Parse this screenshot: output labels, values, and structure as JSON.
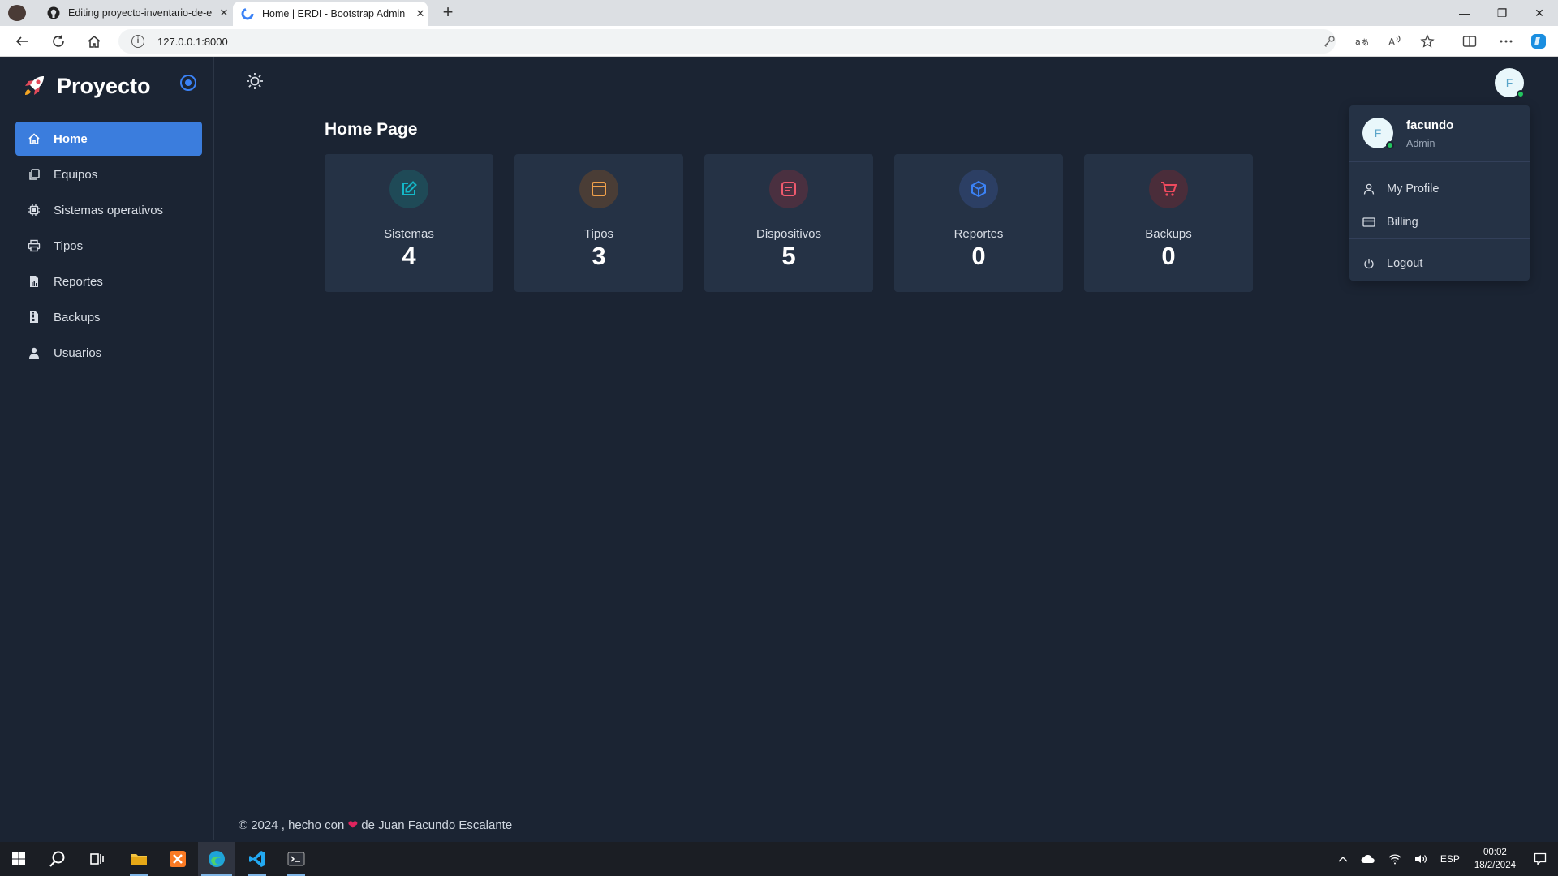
{
  "browser": {
    "tabs": [
      {
        "title": "Editing proyecto-inventario-de-e",
        "close": "✕"
      },
      {
        "title": "Home | ERDI - Bootstrap Admin",
        "close": "✕"
      }
    ],
    "new_tab": "+",
    "url": "127.0.0.1:8000",
    "window_controls": {
      "minimize": "—",
      "restore": "❐",
      "close": "✕"
    }
  },
  "brand": {
    "name": "Proyecto"
  },
  "sidebar": {
    "items": [
      {
        "label": "Home",
        "icon": "home-icon",
        "active": true
      },
      {
        "label": "Equipos",
        "icon": "copy-icon"
      },
      {
        "label": "Sistemas operativos",
        "icon": "cpu-icon"
      },
      {
        "label": "Tipos",
        "icon": "printer-icon"
      },
      {
        "label": "Reportes",
        "icon": "file-chart-icon"
      },
      {
        "label": "Backups",
        "icon": "file-archive-icon"
      },
      {
        "label": "Usuarios",
        "icon": "users-icon"
      }
    ]
  },
  "main": {
    "page_title": "Home Page",
    "cards": [
      {
        "label": "Sistemas",
        "value": "4",
        "icon": "edit-icon",
        "color": "#14b8c8",
        "bg": "#1f4a57"
      },
      {
        "label": "Tipos",
        "value": "3",
        "icon": "window-icon",
        "color": "#f0a04b",
        "bg": "#4a3d36"
      },
      {
        "label": "Dispositivos",
        "value": "5",
        "icon": "document-icon",
        "color": "#f05a6e",
        "bg": "#4a3040"
      },
      {
        "label": "Reportes",
        "value": "0",
        "icon": "box-icon",
        "color": "#3b82f6",
        "bg": "#2c3f64"
      },
      {
        "label": "Backups",
        "value": "0",
        "icon": "cart-icon",
        "color": "#f04a5e",
        "bg": "#4a2d3a"
      }
    ]
  },
  "user": {
    "initial": "F",
    "name": "facundo",
    "role": "Admin",
    "menu": [
      {
        "label": "My Profile",
        "icon": "user-icon"
      },
      {
        "label": "Billing",
        "icon": "credit-card-icon"
      },
      {
        "label": "Logout",
        "icon": "power-icon"
      }
    ]
  },
  "footer": {
    "before": "© 2024 , hecho con",
    "heart": "❤",
    "after": "de Juan Facundo Escalante"
  },
  "taskbar": {
    "lang": "ESP",
    "time": "00:02",
    "date": "18/2/2024"
  },
  "colors": {
    "accent": "#3b7ddd",
    "background": "#1b2433",
    "card": "#253245",
    "online": "#22c55e"
  }
}
